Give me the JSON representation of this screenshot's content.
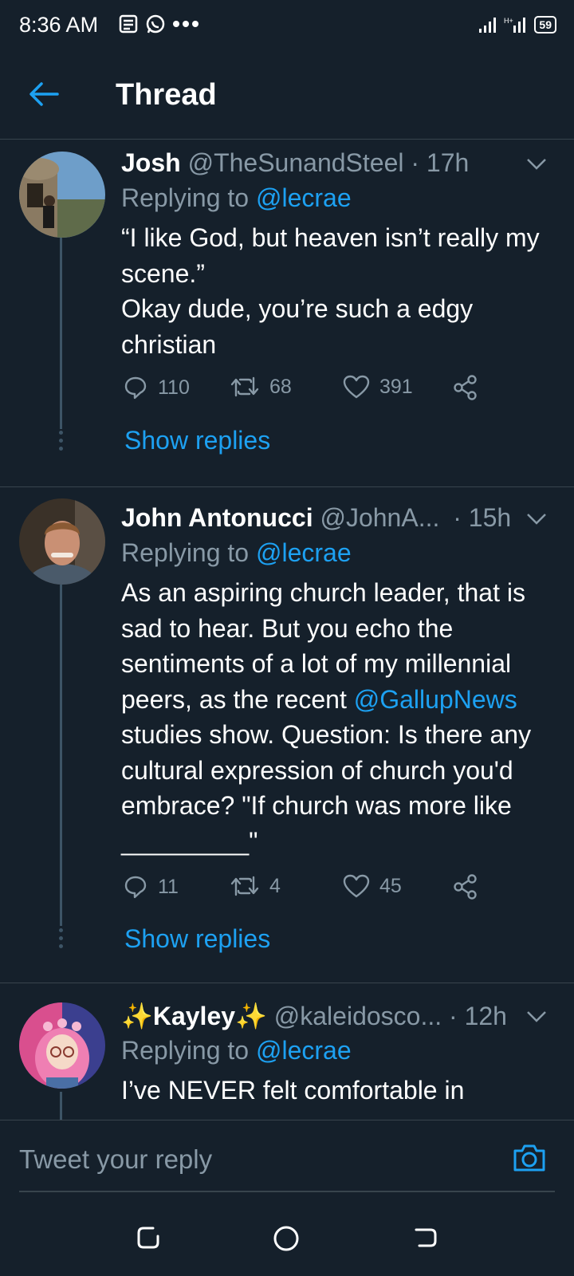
{
  "status_bar": {
    "time": "8:36 AM",
    "battery": "59"
  },
  "header": {
    "title": "Thread"
  },
  "tweets": [
    {
      "name": "Josh",
      "handle": "@TheSunandSteel",
      "time": "· 17h",
      "replying_prefix": "Replying to ",
      "replying_handle": "@lecrae",
      "body_lines": [
        "“I like God, but heaven isn’t really my",
        "scene.”",
        "Okay dude, you’re such a edgy",
        "christian"
      ],
      "replies": "110",
      "retweets": "68",
      "likes": "391",
      "show_replies": "Show replies"
    },
    {
      "name": "John Antonucci",
      "handle": "@JohnA...",
      "time": "· 15h",
      "replying_prefix": "Replying to ",
      "replying_handle": "@lecrae",
      "body_lines": [
        "As an aspiring church leader, that is",
        "sad to hear. But you echo the",
        "sentiments of a lot of my millennial"
      ],
      "body_line4_pre": "peers, as the recent ",
      "body_line4_link": "@GallupNews",
      "body_lines_after": [
        "studies show. Question: Is there any",
        "cultural expression of church you'd",
        "embrace? \"If church was more like",
        "_________\""
      ],
      "replies": "11",
      "retweets": "4",
      "likes": "45",
      "show_replies": "Show replies"
    },
    {
      "name": "✨Kayley✨",
      "handle": "@kaleidosco...",
      "time": "· 12h",
      "replying_prefix": "Replying to ",
      "replying_handle": "@lecrae",
      "body_lines": [
        "I’ve NEVER felt comfortable in"
      ]
    }
  ],
  "composer": {
    "placeholder": "Tweet your reply"
  },
  "colors": {
    "background": "#15202b",
    "accent": "#1da1f2",
    "muted": "#8899a6",
    "divider": "#38444d"
  }
}
